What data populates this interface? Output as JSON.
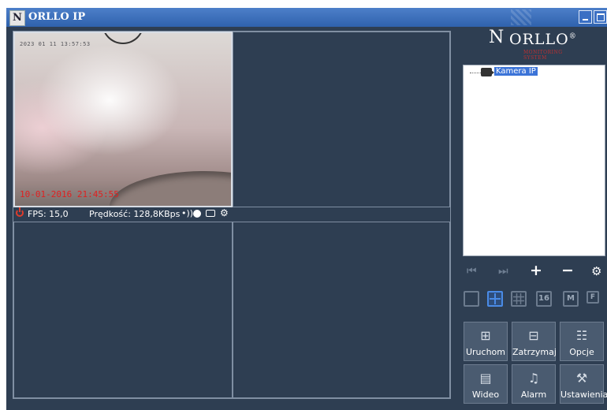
{
  "window": {
    "title": "ORLLO IP",
    "app_icon_glyph": "N"
  },
  "viewer": {
    "feed_top_stamp": "2023 01 11 13:57:53",
    "feed_bottom_stamp": "10-01-2016 21:45:55",
    "fps_text": "FPS: 15,0",
    "speed_text": "Prędkość: 128,8KBps"
  },
  "brand": {
    "mark": "N",
    "name": "ORLLO",
    "reg": "®",
    "tagline": "MONITORING SYSTEM"
  },
  "tree": {
    "items": [
      {
        "label": "Kamera IP"
      }
    ]
  },
  "nav": {
    "first": "⏮",
    "last": "⏭",
    "add": "+",
    "remove": "−",
    "settings": "⚙"
  },
  "layouts": {
    "sixteen": "16",
    "m": "M",
    "f": "F"
  },
  "actions": {
    "start": "Uruchom",
    "stop": "Zatrzymaj",
    "options": "Opcje",
    "video": "Wideo",
    "alarm": "Alarm",
    "settings": "Ustawienia"
  },
  "colors": {
    "background": "#2e3e52",
    "titlebar": "#2f62ad",
    "timestamp_red": "#e02020",
    "selection": "#3c74d8"
  }
}
